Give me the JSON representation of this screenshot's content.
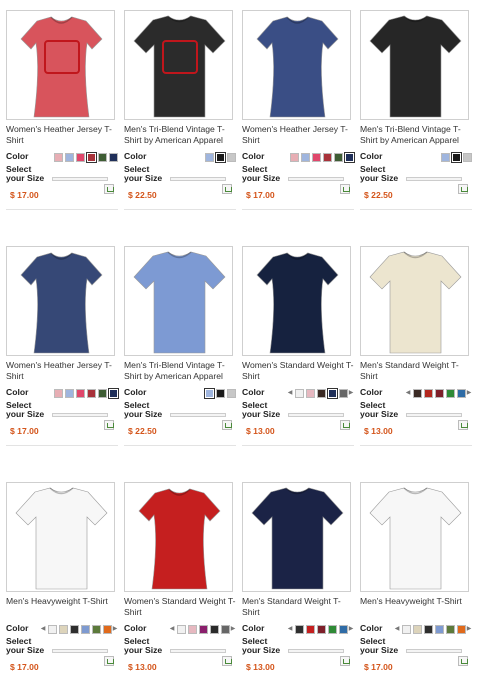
{
  "labels": {
    "color": "Color",
    "select_size": "Select your Size"
  },
  "products": [
    {
      "title": "Women's Heather Jersey T-Shirt",
      "price": "$ 17.00",
      "icon": "tshirt-38geary-women-heather-red-icon",
      "shirt": "#d8545c",
      "design": "38geary",
      "ink": "#c0161c",
      "fit": "women",
      "swatches": [
        "#e7aeb4",
        "#9fb5de",
        "#e0476b",
        "#a8323a",
        "#3e5d34",
        "#1f2f59"
      ],
      "selected": 3,
      "arrows": false
    },
    {
      "title": "Men's Tri-Blend Vintage T-Shirt by American Apparel",
      "price": "$ 22.50",
      "icon": "tshirt-38geary-men-triblend-black-icon",
      "shirt": "#2b2b2b",
      "design": "38geary",
      "ink": "#c0161c",
      "fit": "men",
      "swatches": [
        "#9fb5de",
        "#1a1a1a",
        "#c7c7c7"
      ],
      "selected": 1,
      "arrows": false
    },
    {
      "title": "Women's Heather Jersey T-Shirt",
      "price": "$ 17.00",
      "icon": "tshirt-24divisadero-women-heather-navy-icon",
      "shirt": "#3a4e85",
      "design": "24",
      "ink": "#4ab7d8",
      "fit": "women",
      "swatches": [
        "#e7aeb4",
        "#9fb5de",
        "#e0476b",
        "#a8323a",
        "#3e5d34",
        "#1f2f59"
      ],
      "selected": 5,
      "arrows": false
    },
    {
      "title": "Men's Tri-Blend Vintage T-Shirt by American Apparel",
      "price": "$ 22.50",
      "icon": "tshirt-24divisadero-men-triblend-black-icon",
      "shirt": "#262626",
      "design": "24",
      "ink": "#8fc3e4",
      "fit": "men",
      "swatches": [
        "#9fb5de",
        "#1a1a1a",
        "#c7c7c7"
      ],
      "selected": 1,
      "arrows": false
    },
    {
      "title": "Women's Heather Jersey T-Shirt",
      "price": "$ 17.00",
      "icon": "tshirt-22fillmore-women-heather-navy-icon",
      "shirt": "#364876",
      "design": "22",
      "ink": "#f2cb18",
      "fit": "women",
      "swatches": [
        "#e7aeb4",
        "#9fb5de",
        "#e0476b",
        "#a8323a",
        "#3e5d34",
        "#1f2f59"
      ],
      "selected": 5,
      "arrows": false
    },
    {
      "title": "Men's Tri-Blend Vintage T-Shirt by American Apparel",
      "price": "$ 22.50",
      "icon": "tshirt-22fillmore-men-triblend-blue-icon",
      "shirt": "#7d9ad3",
      "design": "22",
      "ink": "#f2cb18",
      "fit": "men",
      "swatches": [
        "#9fb5de",
        "#1a1a1a",
        "#c7c7c7"
      ],
      "selected": 0,
      "arrows": false
    },
    {
      "title": "Women's Standard Weight T-Shirt",
      "price": "$ 13.00",
      "icon": "tshirt-24divisadero-women-standard-navy-icon",
      "shirt": "#16223f",
      "design": "24",
      "ink": "#4ab7d8",
      "fit": "women",
      "swatches": [
        "#f1f1f1",
        "#e6b8c0",
        "#3a2a24",
        "#1f2f59",
        "#666666"
      ],
      "selected": 3,
      "arrows": true
    },
    {
      "title": "Men's Standard Weight T-Shirt",
      "price": "$ 13.00",
      "icon": "tshirt-24divisadero-men-standard-natural-icon",
      "shirt": "#ece5cf",
      "design": "24",
      "ink": "#1f9fd8",
      "fit": "men",
      "swatches": [
        "#3a2a24",
        "#b3271e",
        "#7e1f2a",
        "#2f8a36",
        "#2f6ca6"
      ],
      "selected": -1,
      "arrows": true
    },
    {
      "title": "Men's Heavyweight T-Shirt",
      "price": "$ 17.00",
      "icon": "tshirt-24divisadero-men-heavyweight-white-icon",
      "shirt": "#f7f7f7",
      "design": "24",
      "ink": "#1f9fd8",
      "fit": "men",
      "swatches": [
        "#f1f1f1",
        "#ddd4bb",
        "#2e2e2e",
        "#7e9ad0",
        "#5c7a3b",
        "#e06a1c"
      ],
      "selected": -1,
      "arrows": true
    },
    {
      "title": "Women's Standard Weight T-Shirt",
      "price": "$ 13.00",
      "icon": "tshirt-22fillmore-women-standard-red-icon",
      "shirt": "#c51f1f",
      "design": "22",
      "ink": "#ffffff",
      "fit": "women",
      "swatches": [
        "#f1f1f1",
        "#e6b8c0",
        "#8a1f6c",
        "#2a2a2a",
        "#666666"
      ],
      "selected": -1,
      "arrows": true
    },
    {
      "title": "Men's Standard Weight T-Shirt",
      "price": "$ 13.00",
      "icon": "tshirt-22fillmore-men-standard-navy-icon",
      "shirt": "#1b2346",
      "design": "22",
      "ink": "#e8541c",
      "fit": "men",
      "swatches": [
        "#2e2e2e",
        "#c51f1f",
        "#7e1f2a",
        "#2f8a36",
        "#2f6ca6"
      ],
      "selected": -1,
      "arrows": true
    },
    {
      "title": "Men's Heavyweight T-Shirt",
      "price": "$ 17.00",
      "icon": "tshirt-22fillmore-men-heavyweight-white-icon",
      "shirt": "#f7f7f7",
      "design": "22",
      "ink": "#e8541c",
      "fit": "men",
      "swatches": [
        "#f1f1f1",
        "#ddd4bb",
        "#2e2e2e",
        "#7e9ad0",
        "#5c7a3b",
        "#e06a1c"
      ],
      "selected": -1,
      "arrows": true
    }
  ]
}
